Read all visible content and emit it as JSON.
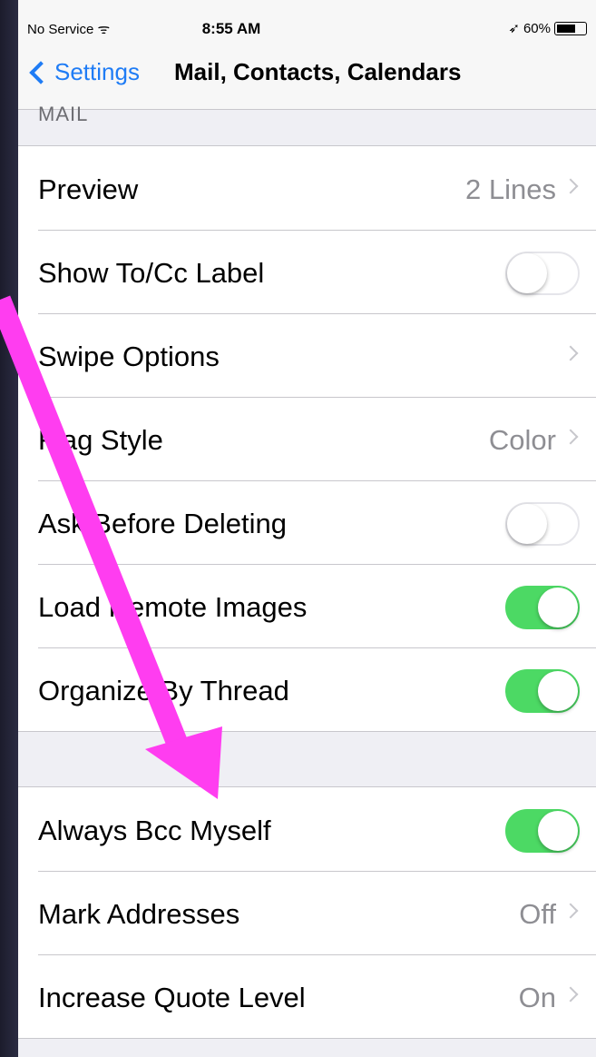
{
  "status_bar": {
    "carrier": "No Service",
    "time": "8:55 AM",
    "battery": "60%"
  },
  "nav": {
    "back_label": "Settings",
    "title": "Mail, Contacts, Calendars"
  },
  "section": {
    "mail_header": "MAIL"
  },
  "group1": [
    {
      "label": "Preview",
      "value": "2 Lines",
      "type": "disclosure"
    },
    {
      "label": "Show To/Cc Label",
      "type": "toggle",
      "on": false
    },
    {
      "label": "Swipe Options",
      "value": "",
      "type": "disclosure"
    },
    {
      "label": "Flag Style",
      "value": "Color",
      "type": "disclosure"
    },
    {
      "label": "Ask Before Deleting",
      "type": "toggle",
      "on": false
    },
    {
      "label": "Load Remote Images",
      "type": "toggle",
      "on": true
    },
    {
      "label": "Organize By Thread",
      "type": "toggle",
      "on": true
    }
  ],
  "group2": [
    {
      "label": "Always Bcc Myself",
      "type": "toggle",
      "on": true
    },
    {
      "label": "Mark Addresses",
      "value": "Off",
      "type": "disclosure"
    },
    {
      "label": "Increase Quote Level",
      "value": "On",
      "type": "disclosure"
    }
  ],
  "colors": {
    "accent": "#1f7cf5",
    "toggle_on": "#4cd964",
    "annotation_arrow": "#ff3df0"
  }
}
